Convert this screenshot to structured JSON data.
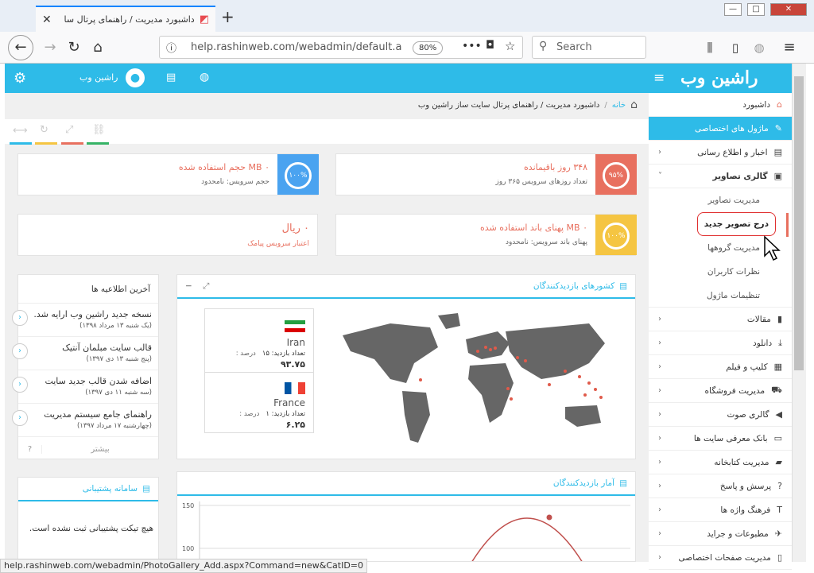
{
  "browser": {
    "tab_title": "داشبورد مدیریت / راهنمای پرتال سا",
    "url": "help.rashinweb.com/webadmin/default.a",
    "url_host": "help.rashinweb.com",
    "zoom": "80%",
    "search_placeholder": "Search",
    "status_url": "help.rashinweb.com/webadmin/PhotoGallery_Add.aspx?Command=new&CatID=0"
  },
  "header": {
    "user_name": "راشین وب",
    "logo_text": "راشین وب"
  },
  "breadcrumb": {
    "home": "خانه",
    "current": "داشبورد مدیریت / راهنمای پرتال سایت ساز راشین وب"
  },
  "stats": [
    {
      "value": "۳۴۸ روز باقیمانده",
      "desc": "تعداد روزهای سرویس ۳۶۵ روز",
      "percent": "۹۵%",
      "color": "#e8705f"
    },
    {
      "value": "۰ MB حجم استفاده شده",
      "desc": "حجم سرویس: نامحدود",
      "percent": "۱۰۰%",
      "color": "#4aa3f0"
    },
    {
      "value": "۰ MB پهنای باند استفاده شده",
      "desc": "پهنای باند سرویس: نامحدود",
      "percent": "۱۰۰%",
      "color": "#f5c542"
    },
    {
      "value": "۰ ریال",
      "desc": "اعتبار سرویس پیامک"
    }
  ],
  "visitors_map": {
    "title": "کشورهای بازدیدکنندگان",
    "countries": [
      {
        "name": "Iran",
        "visits_label": "تعداد بازدید: ۱۵",
        "percent_label": "درصد :",
        "percent": "۹۳.۷۵"
      },
      {
        "name": "France",
        "visits_label": "تعداد بازدید: ۱",
        "percent_label": "درصد :",
        "percent": "۶.۲۵"
      }
    ]
  },
  "news": {
    "title": "آخرین اطلاعیه ها",
    "items": [
      {
        "title": "نسخه جدید راشین وب ارایه شد.",
        "date": "(یک شنبه ۱۳ مرداد ۱۳۹۸)"
      },
      {
        "title": "قالب سایت مبلمان آنتیک",
        "date": "(پنج شنبه ۱۳ دی ۱۳۹۷)"
      },
      {
        "title": "اضافه شدن قالب جدید سایت",
        "date": "(سه شنبه ۱۱ دی ۱۳۹۷)"
      },
      {
        "title": "راهنمای جامع سیستم مدیریت",
        "date": "(چهارشنبه ۱۷ مرداد ۱۳۹۷)"
      }
    ],
    "more": "بیشتر",
    "help": "?"
  },
  "support": {
    "title": "سامانه پشتیبانی",
    "empty": "هیچ تیکت پشتیبانی ثبت نشده است."
  },
  "visits_chart": {
    "title": "آمار بازدیدکنندگان"
  },
  "chart_data": {
    "type": "line",
    "y_ticks": [
      "150",
      "100"
    ],
    "series": [
      {
        "values": [
          135
        ]
      }
    ]
  },
  "sidebar": {
    "items": [
      {
        "label": "داشبورد",
        "icon": "home-icon",
        "arrow": ""
      },
      {
        "label": "ماژول های اختصاصی",
        "icon": "pencil-icon",
        "arrow": "",
        "active": true
      },
      {
        "label": "اخبار و اطلاع رسانی",
        "icon": "newspaper-icon",
        "arrow": "‹"
      },
      {
        "label": "گالری تصاویر",
        "icon": "image-icon",
        "arrow": "˅"
      }
    ],
    "gallery_sub": [
      "مدیریت تصاویر",
      "درج تصویر جدید",
      "مدیریت گروهها",
      "نظرات کاربران",
      "تنظیمات ماژول"
    ],
    "items2": [
      {
        "label": "مقالات",
        "icon": "file-icon"
      },
      {
        "label": "دانلود",
        "icon": "download-icon"
      },
      {
        "label": "کلیپ و فیلم",
        "icon": "film-icon"
      },
      {
        "label": "مدیریت فروشگاه",
        "icon": "cart-icon"
      },
      {
        "label": "گالری صوت",
        "icon": "volume-icon"
      },
      {
        "label": "بانک معرفی سایت ها",
        "icon": "monitor-icon"
      },
      {
        "label": "مدیریت کتابخانه",
        "icon": "book-icon"
      },
      {
        "label": "پرسش و پاسخ",
        "icon": "question-icon"
      },
      {
        "label": "فرهنگ واژه ها",
        "icon": "text-icon"
      },
      {
        "label": "مطبوعات و جراید",
        "icon": "pin-icon"
      },
      {
        "label": "مدیریت صفحات اختصاصی",
        "icon": "page-icon"
      }
    ]
  }
}
